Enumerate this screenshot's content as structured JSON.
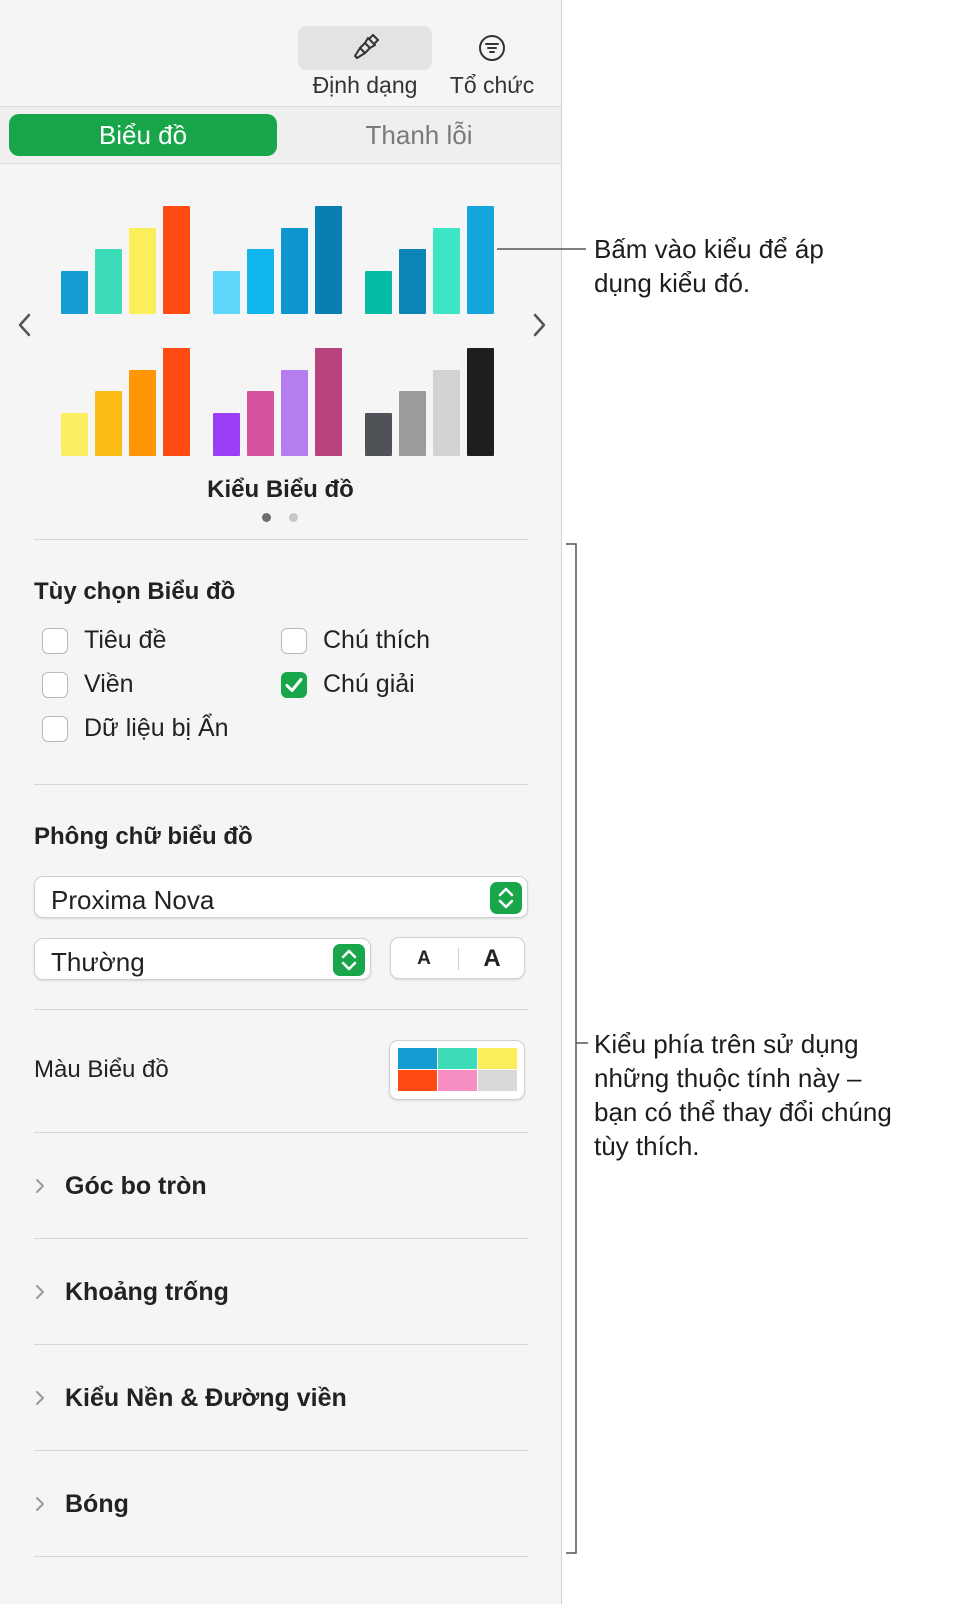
{
  "toolbar": {
    "format_label": "Định dạng",
    "organize_label": "Tổ chức",
    "format_icon": "paintbrush-icon",
    "organize_icon": "filter-list-icon"
  },
  "tabs": [
    {
      "label": "Biểu đồ",
      "active": true
    },
    {
      "label": "Thanh lỗi",
      "active": false
    }
  ],
  "chart_styles": {
    "title": "Kiểu Biểu đồ",
    "page_count": 2,
    "current_page": 1,
    "items": [
      {
        "name": "style-1",
        "colors": [
          "#159cd2",
          "#3ddcb8",
          "#fbee5b",
          "#ff4b12"
        ],
        "levels": [
          0.4,
          0.6,
          0.8,
          1.0
        ]
      },
      {
        "name": "style-2",
        "colors": [
          "#5fd7fb",
          "#12b6ef",
          "#0e95cd",
          "#0a7eb0"
        ],
        "levels": [
          0.4,
          0.6,
          0.8,
          1.0
        ]
      },
      {
        "name": "style-3",
        "colors": [
          "#07bca7",
          "#0d84b8",
          "#3ee4c6",
          "#12a6dc"
        ],
        "levels": [
          0.4,
          0.6,
          0.8,
          1.0
        ]
      },
      {
        "name": "style-4",
        "colors": [
          "#fbee63",
          "#fbbc15",
          "#ff9606",
          "#ff4b12"
        ],
        "levels": [
          0.4,
          0.6,
          0.8,
          1.0
        ]
      },
      {
        "name": "style-5",
        "colors": [
          "#9b3ff6",
          "#d6539d",
          "#b67df1",
          "#b8437c"
        ],
        "levels": [
          0.4,
          0.6,
          0.8,
          1.0
        ]
      },
      {
        "name": "style-6",
        "colors": [
          "#4f5358",
          "#9b9b9b",
          "#d2d2d2",
          "#1e1e1e"
        ],
        "levels": [
          0.4,
          0.6,
          0.8,
          1.0
        ]
      }
    ]
  },
  "chart_options": {
    "title": "Tùy chọn Biểu đồ",
    "items": [
      {
        "label": "Tiêu đề",
        "checked": false
      },
      {
        "label": "Chú thích",
        "checked": false
      },
      {
        "label": "Viền",
        "checked": false
      },
      {
        "label": "Chú giải",
        "checked": true
      },
      {
        "label": "Dữ liệu bị Ẩn",
        "checked": false
      }
    ]
  },
  "chart_font": {
    "title": "Phông chữ biểu đồ",
    "family": "Proxima Nova",
    "style": "Thường",
    "smaller_label": "A",
    "larger_label": "A"
  },
  "chart_colors": {
    "label": "Màu Biểu đồ",
    "swatch": [
      "#159cd2",
      "#3ddcb8",
      "#fbee5b",
      "#ff4b12",
      "#f78fc4",
      "#d9d9d9"
    ]
  },
  "sections": [
    {
      "label": "Góc bo tròn"
    },
    {
      "label": "Khoảng trống"
    },
    {
      "label": "Kiểu Nền & Đường viền"
    },
    {
      "label": "Bóng"
    }
  ],
  "callouts": {
    "styles_note": [
      "Bấm vào kiểu để áp",
      "dụng kiểu đó."
    ],
    "properties_note": [
      "Kiểu phía trên sử dụng",
      "những thuộc tính này –",
      "bạn có thể thay đổi chúng",
      "tùy thích."
    ]
  },
  "colors": {
    "accent": "#19a64a"
  }
}
